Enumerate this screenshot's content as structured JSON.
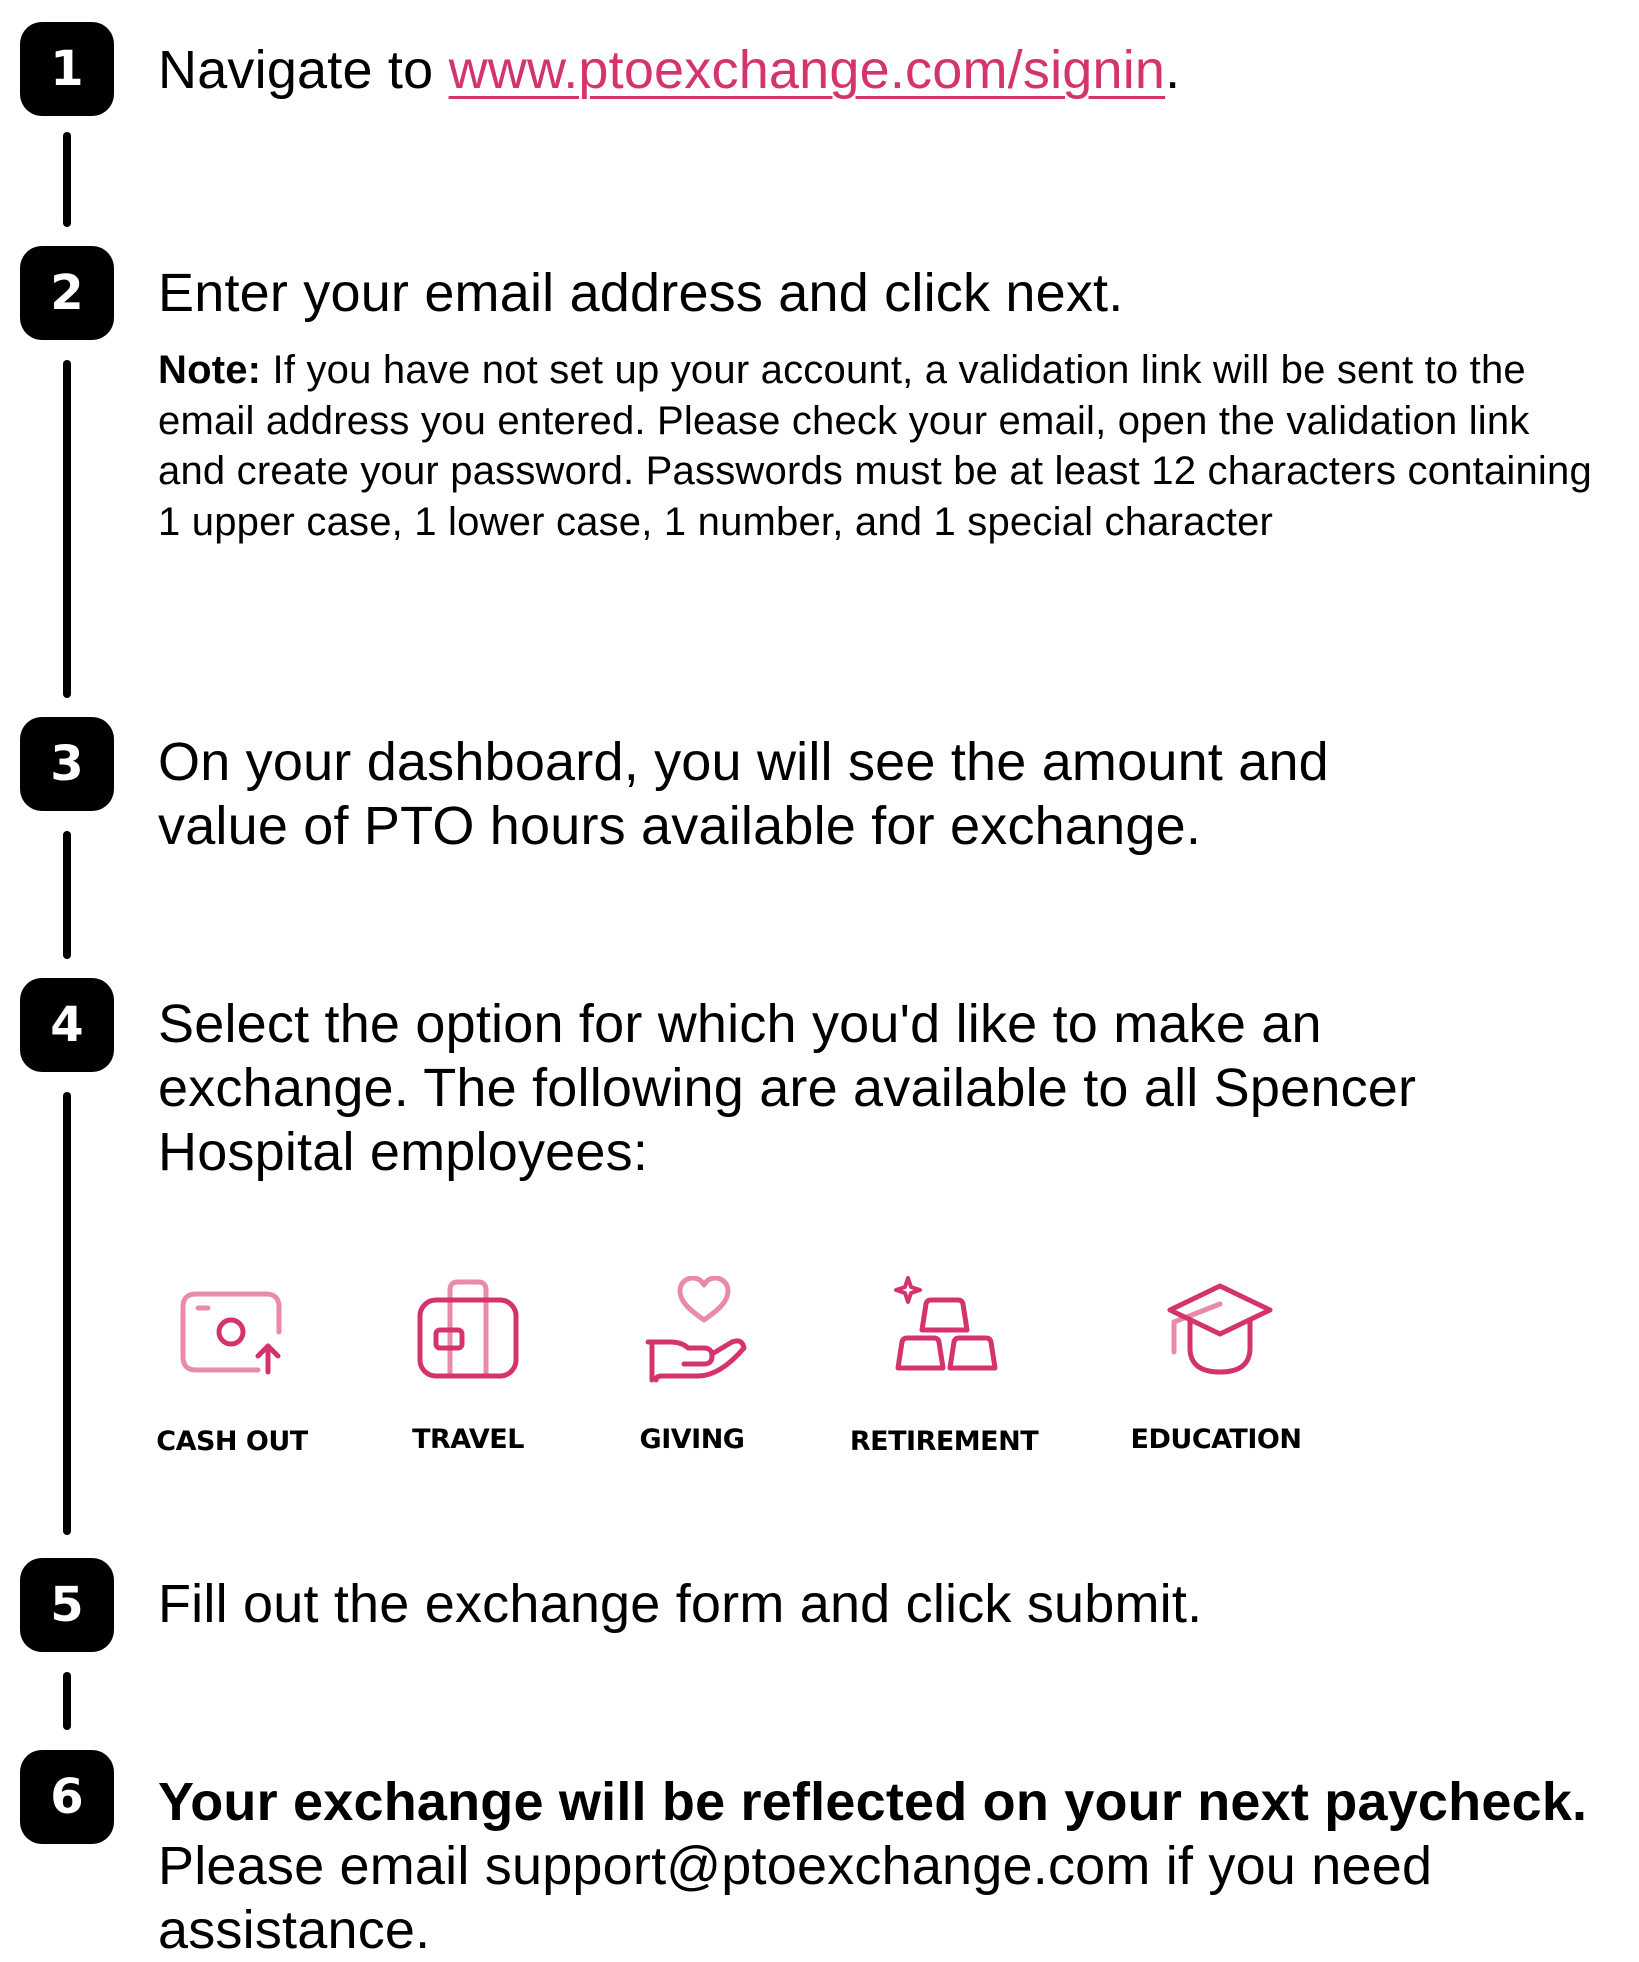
{
  "colors": {
    "accent": "#d4336d",
    "accent_light": "#e88aaa",
    "badge": "#000000"
  },
  "steps": [
    {
      "number": "1",
      "text_before": "Navigate to ",
      "link": "www.ptoexchange.com/signin",
      "text_after": "."
    },
    {
      "number": "2",
      "text": "Enter your email address and click next.",
      "note_label": "Note:",
      "note_text": " If you have not set up your account, a validation link will be sent to the email address you entered. Please check your email, open the validation link and create your password. Passwords must be at least 12 characters containing 1 upper case, 1 lower case, 1 number, and 1 special character"
    },
    {
      "number": "3",
      "line1": "On your dashboard, you will see the amount and",
      "line2": "value of PTO hours available for exchange."
    },
    {
      "number": "4",
      "line1": "Select the option for which you'd like to make an",
      "line2": "exchange. The following are available to all Spencer",
      "line3": "Hospital employees:"
    },
    {
      "number": "5",
      "text": "Fill out the exchange form and click submit."
    },
    {
      "number": "6",
      "bold_text": "Your exchange will be reflected on your next paycheck.",
      "line2": "Please email support@ptoexchange.com if you need",
      "line3": "assistance."
    }
  ],
  "options": [
    {
      "label": "CASH OUT",
      "icon": "camera-upload-icon"
    },
    {
      "label": "TRAVEL",
      "icon": "suitcase-icon"
    },
    {
      "label": "GIVING",
      "icon": "hand-heart-icon"
    },
    {
      "label": "RETIREMENT",
      "icon": "gold-bars-icon"
    },
    {
      "label": "EDUCATION",
      "icon": "graduation-cap-icon"
    }
  ]
}
